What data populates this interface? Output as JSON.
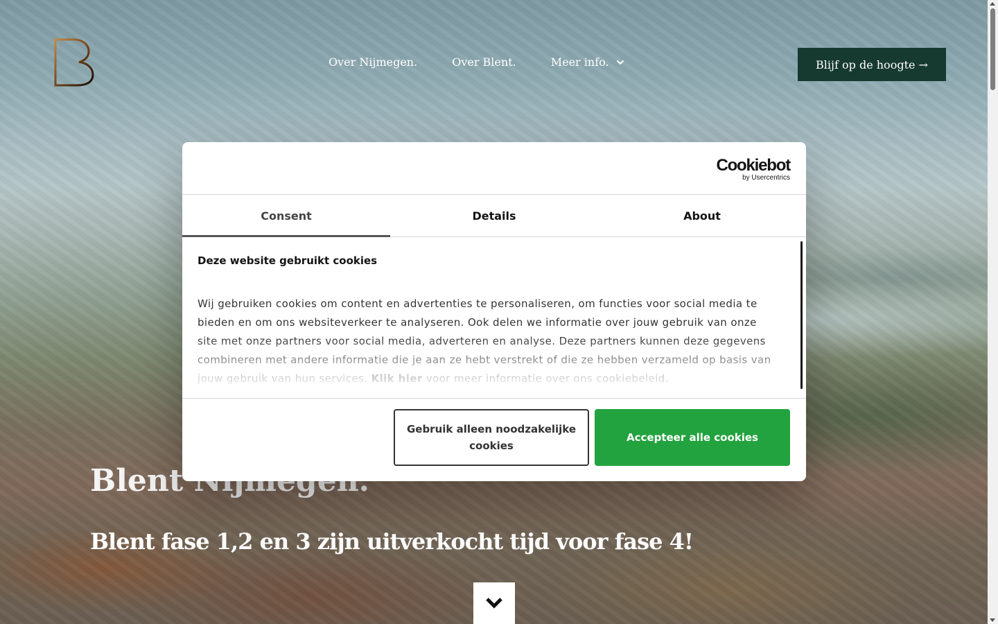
{
  "nav": {
    "items": [
      {
        "label": "Over Nijmegen."
      },
      {
        "label": "Over Blent."
      },
      {
        "label": "Meer info."
      }
    ],
    "cta_label": "Blijf op de hoogte →"
  },
  "hero": {
    "title": "Blent Nijmegen.",
    "subtitle": "Blent fase 1,2 en 3 zijn uitverkocht tijd voor fase 4!"
  },
  "cookie_dialog": {
    "brand": "Cookiebot",
    "brand_by": "by Usercentrics",
    "tabs": [
      {
        "label": "Consent",
        "active": true
      },
      {
        "label": "Details",
        "active": false
      },
      {
        "label": "About",
        "active": false
      }
    ],
    "heading": "Deze website gebruikt cookies",
    "text": "Wij gebruiken cookies om content en advertenties te personaliseren, om functies voor social media te bieden en om ons websiteverkeer te analyseren. Ook delen we informatie over jouw gebruik van onze site met onze partners voor social media, adverteren en analyse. Deze partners kunnen deze gegevens combineren met andere informatie die je aan ze hebt verstrekt of die ze hebben verzameld op basis van jouw gebruik van hun services.",
    "link_label": "Klik hier",
    "text_after_link": "voor meer informatie over ons cookiebeleid.",
    "btn_necessary": "Gebruik alleen noodzakelijke cookies",
    "btn_accept": "Accepteer alle cookies",
    "accept_color": "#23a33f"
  },
  "colors": {
    "cta_bg": "#173a30",
    "logo_gradient": [
      "#b77a3a",
      "#1c1008"
    ]
  },
  "icons": {
    "logo": "blent-b-logo",
    "nav_dropdown": "chevron-down-icon",
    "scroll_down": "chevron-down-icon"
  }
}
